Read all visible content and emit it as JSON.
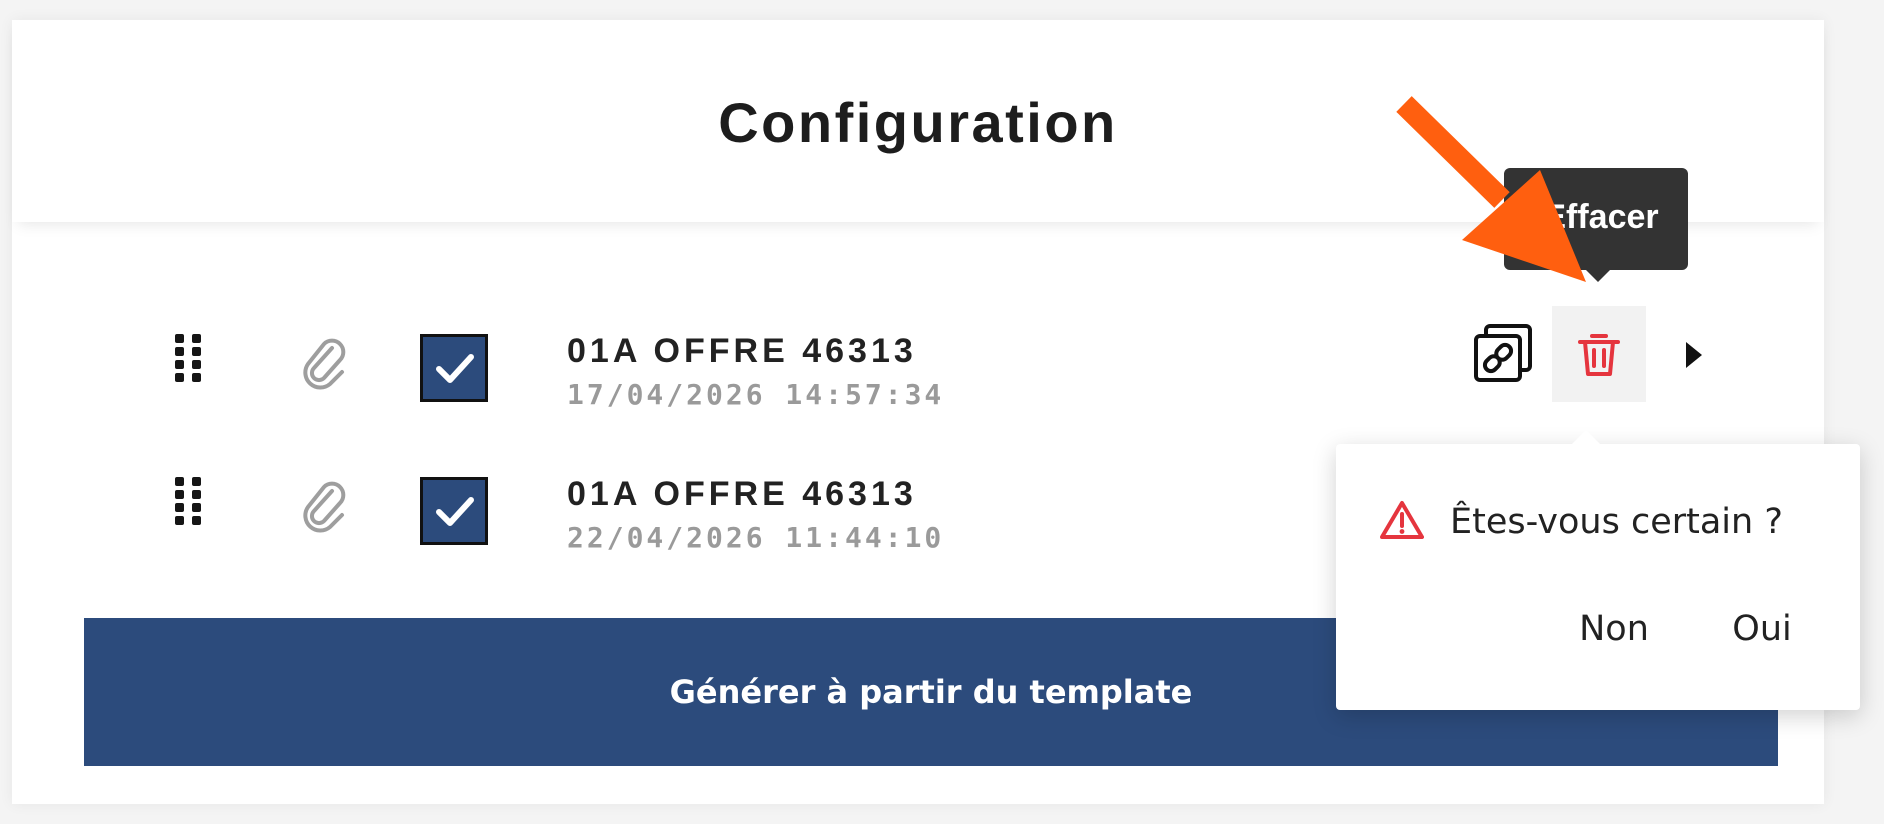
{
  "header": {
    "title": "Configuration"
  },
  "items": [
    {
      "name": "01A OFFRE 46313",
      "date": "17/04/2026 14:57:34",
      "checked": true
    },
    {
      "name": "01A OFFRE 46313",
      "date": "22/04/2026 11:44:10",
      "checked": true
    }
  ],
  "actions": {
    "delete_tooltip": "Effacer",
    "link_icon": "link-copy-icon",
    "delete_icon": "trash-icon",
    "expand_icon": "caret-right-icon"
  },
  "generate_button": {
    "label": "Générer à partir du template"
  },
  "popconfirm": {
    "message": "Êtes-vous certain ?",
    "cancel_label": "Non",
    "confirm_label": "Oui",
    "icon": "warning-icon"
  },
  "colors": {
    "primary": "#2c4b7c",
    "danger": "#e5353e",
    "tooltip_bg": "#333333",
    "annotation": "#ff5f0f",
    "date_text": "#9a9a9a"
  }
}
